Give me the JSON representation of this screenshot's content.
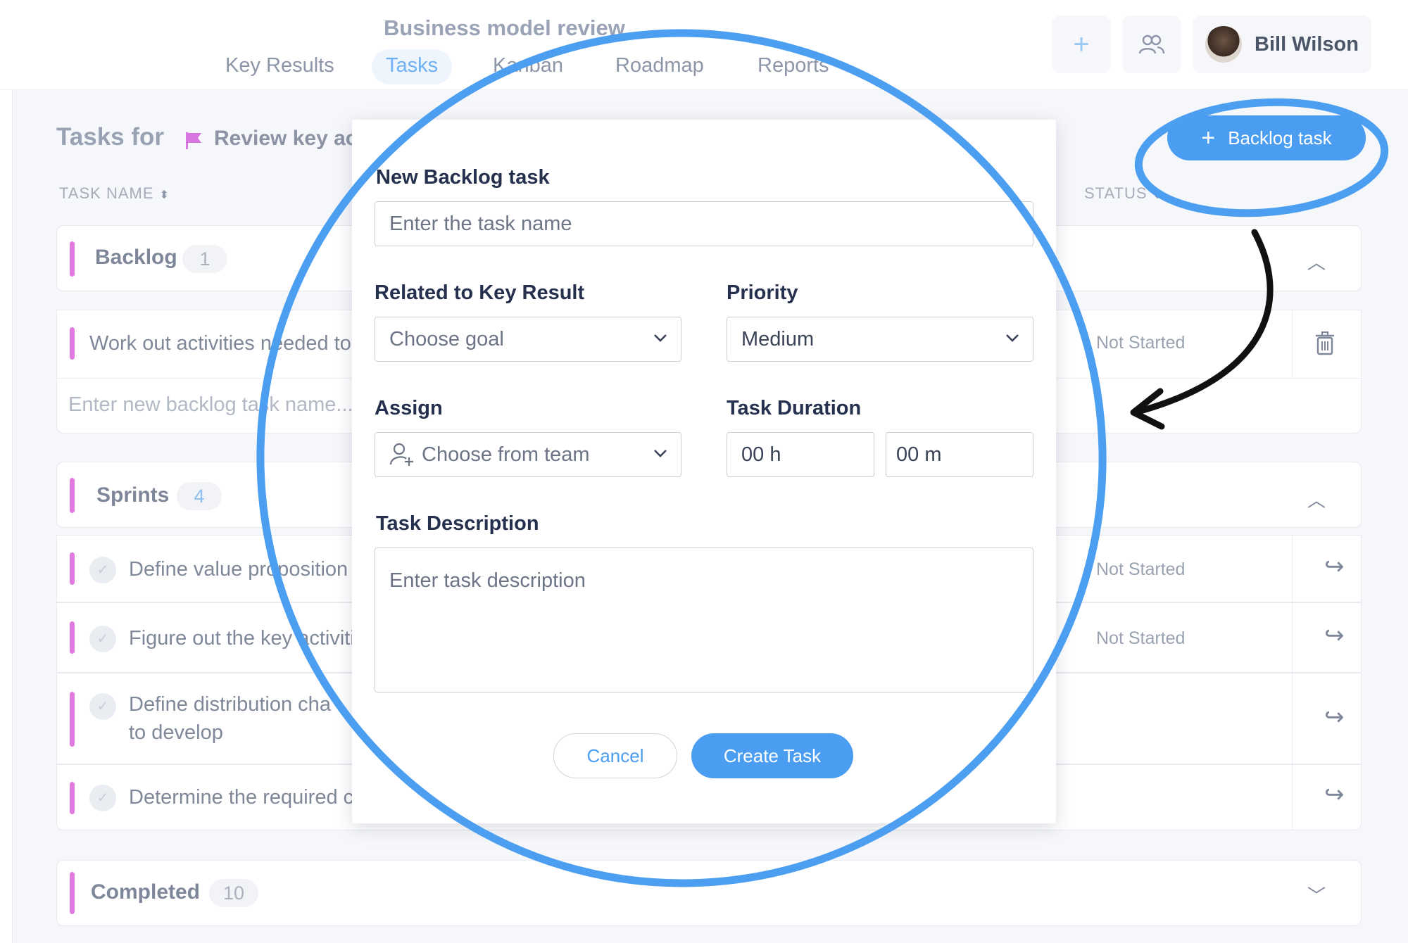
{
  "header": {
    "project_title": "Business model review",
    "nav": [
      "Key Results",
      "Tasks",
      "Kanban",
      "Roadmap",
      "Reports"
    ],
    "active_tab": "Tasks",
    "user_name": "Bill Wilson",
    "icons": [
      "plus-icon",
      "team-icon",
      "avatar"
    ]
  },
  "page": {
    "tasks_for": "Tasks for",
    "objective": "Review key act",
    "col_task_name": "TASK NAME",
    "col_status": "STATUS",
    "backlog_button": "Backlog task"
  },
  "groups": {
    "backlog": {
      "title": "Backlog",
      "count": "1",
      "rows": [
        {
          "text": "Work out activities needed to",
          "status": "Not Started"
        }
      ],
      "new_placeholder": "Enter new backlog task name..."
    },
    "sprints": {
      "title": "Sprints",
      "count": "4",
      "rows": [
        {
          "text": "Define value proposition",
          "status": "Not Started"
        },
        {
          "text": "Figure out the key activiti",
          "status": "Not Started"
        },
        {
          "text": "Define distribution cha",
          "text2": "to develop",
          "status": ""
        },
        {
          "text": "Determine the required c",
          "status": ""
        }
      ]
    },
    "completed": {
      "title": "Completed",
      "count": "10"
    }
  },
  "modal": {
    "title": "New Backlog task",
    "task_name_placeholder": "Enter the task name",
    "related_label": "Related to Key Result",
    "related_value": "Choose goal",
    "priority_label": "Priority",
    "priority_value": "Medium",
    "assign_label": "Assign",
    "assign_value": "Choose from team",
    "duration_label": "Task Duration",
    "duration_hours": "00 h",
    "duration_minutes": "00 m",
    "description_label": "Task Description",
    "description_placeholder": "Enter task description",
    "cancel": "Cancel",
    "create": "Create Task"
  },
  "colors": {
    "accent": "#4a9df0",
    "group_bar": "#e07be0",
    "annotation_blue": "#4b9ef0"
  }
}
